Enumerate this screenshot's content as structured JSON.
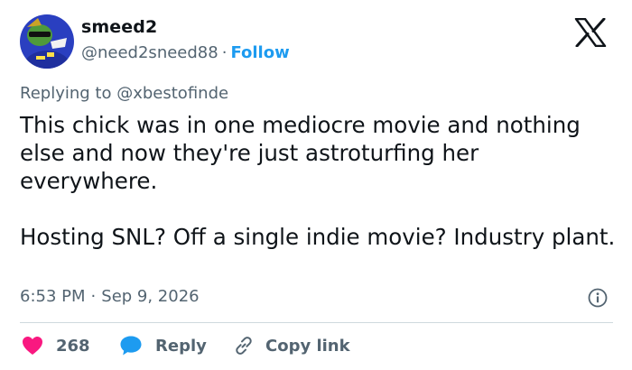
{
  "author": {
    "display_name": "smeed2",
    "handle": "@need2sneed88",
    "separator": "·",
    "follow_label": "Follow"
  },
  "reply_context": {
    "prefix": "Replying to",
    "mention": "@xbestofinde"
  },
  "tweet": {
    "paragraphs": [
      "This chick was in one mediocre movie and nothing else and now they're just astroturfing her everywhere.",
      "Hosting SNL? Off a single indie movie? Industry plant."
    ],
    "time": "6:53 PM",
    "date_separator": "·",
    "date": "Sep 9, 2026"
  },
  "actions": {
    "like_count": "268",
    "reply_label": "Reply",
    "copy_link_label": "Copy link"
  },
  "colors": {
    "heart": "#f91880",
    "reply_bubble": "#1d9bf0",
    "follow": "#1d9bf0",
    "muted": "#536471",
    "avatar_bg": "#2a3fc0"
  },
  "icons": {
    "platform": "x-logo-icon",
    "info": "info-icon",
    "like": "heart-icon",
    "reply": "speech-bubble-icon",
    "copy": "link-icon"
  }
}
